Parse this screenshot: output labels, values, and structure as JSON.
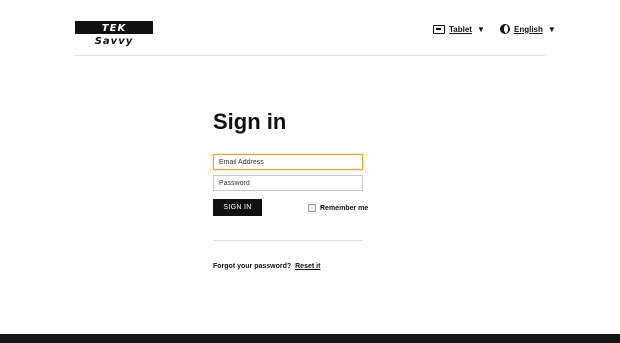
{
  "header": {
    "logo_left": "TEK",
    "logo_right": "Savvy",
    "device": {
      "icon": "tablet-icon",
      "label": "Tablet"
    },
    "language": {
      "icon": "globe-icon",
      "label": "English"
    }
  },
  "form": {
    "title": "Sign in",
    "email_placeholder": "Email Address",
    "email_value": "",
    "password_placeholder": "Password",
    "password_value": "",
    "submit_label": "SIGN IN",
    "remember_label": "Remember me",
    "remember_checked": false,
    "accent_focus": "#e8a33d"
  },
  "footer": {
    "forgot_text": "Forgot your password?",
    "reset_link": "Reset it"
  }
}
